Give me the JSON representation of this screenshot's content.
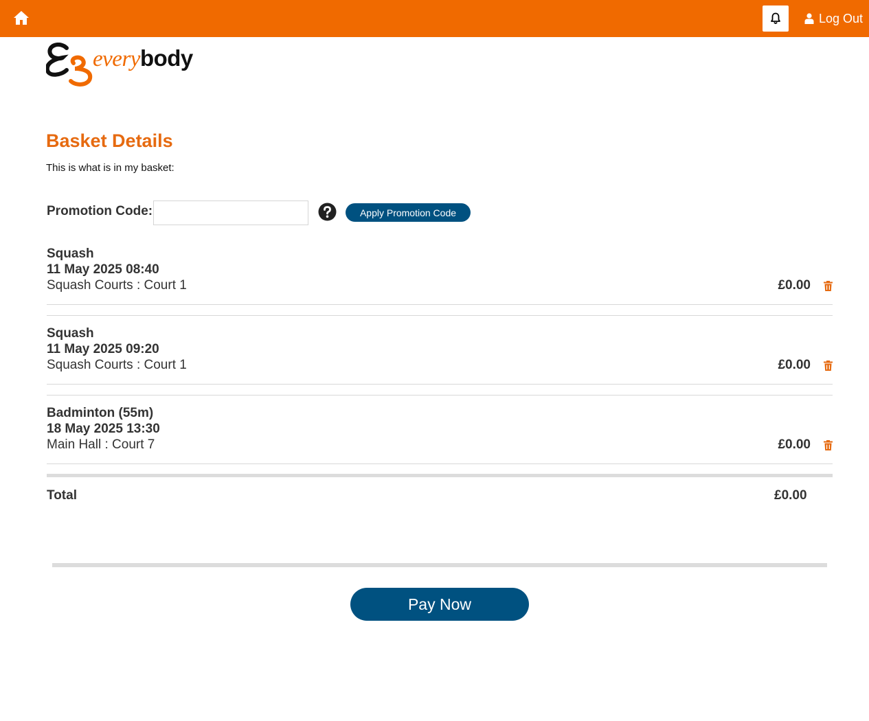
{
  "topbar": {
    "home_icon": "home-icon",
    "bell_icon": "bell-icon",
    "logout_label": "Log Out",
    "color": "#f06a00"
  },
  "logo": {
    "every": "every",
    "body": "body"
  },
  "page": {
    "title": "Basket Details",
    "intro": "This is what is in my basket:"
  },
  "promo": {
    "label": "Promotion Code:",
    "value": "",
    "apply_label": "Apply Promotion Code"
  },
  "basket": {
    "items": [
      {
        "name": "Squash",
        "datetime": "11 May 2025 08:40",
        "location": "Squash Courts : Court 1",
        "price": "£0.00"
      },
      {
        "name": "Squash",
        "datetime": "11 May 2025 09:20",
        "location": "Squash Courts : Court 1",
        "price": "£0.00"
      },
      {
        "name": "Badminton (55m)",
        "datetime": "18 May 2025 13:30",
        "location": "Main Hall : Court 7",
        "price": "£0.00"
      }
    ],
    "total_label": "Total",
    "total_value": "£0.00"
  },
  "actions": {
    "pay_label": "Pay Now",
    "button_color": "#005180"
  }
}
